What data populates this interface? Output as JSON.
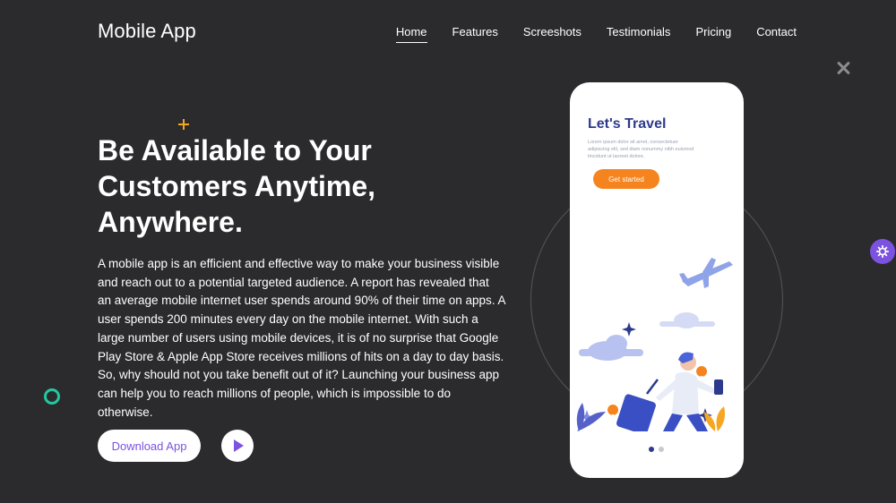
{
  "header": {
    "brand": "Mobile App",
    "nav": [
      {
        "label": "Home",
        "active": true
      },
      {
        "label": "Features"
      },
      {
        "label": "Screeshots"
      },
      {
        "label": "Testimonials"
      },
      {
        "label": "Pricing"
      },
      {
        "label": "Contact"
      }
    ]
  },
  "hero": {
    "title": "Be Available to Your Customers Anytime, Anywhere.",
    "description": "A mobile app is an efficient and effective way to make your business visible and reach out to a potential targeted audience. A report has revealed that an average mobile internet user spends around 90% of their time on apps. A user spends 200 minutes every day on the mobile internet. With such a large number of users using mobile devices, it is of no surprise that Google Play Store & Apple App Store receives millions of hits on a day to day basis. So, why should not you take benefit out of it? Launching your business app can help you to reach millions of people, which is impossible to do otherwise.",
    "download_label": "Download App",
    "play_icon": "play-icon"
  },
  "phone": {
    "title": "Let's Travel",
    "lorem": "Lorem ipsum dolor sit amet, consectetuer adipiscing elit, sed diam nonummy nibh euismod tincidunt ut laoreet dolore.",
    "cta": "Get started",
    "slides": 2,
    "active_slide": 1
  },
  "colors": {
    "background": "#2b2b2e",
    "accent": "#7b53e0",
    "orange": "#f5841f",
    "navy": "#2d3a8c",
    "teal": "#22c9a0",
    "yellow": "#f5a623"
  },
  "icons": {
    "close": "close-icon",
    "plus": "plus-icon",
    "ring": "ring-icon",
    "settings": "gear-icon"
  }
}
